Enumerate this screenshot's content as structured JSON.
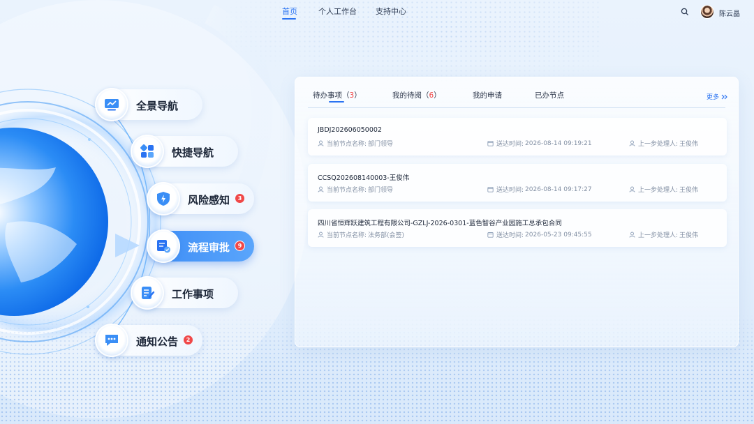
{
  "header": {
    "nav": [
      {
        "label": "首页",
        "active": true
      },
      {
        "label": "个人工作台",
        "active": false
      },
      {
        "label": "支持中心",
        "active": false
      }
    ],
    "user_name": "陈云晶",
    "search_icon": "search-icon"
  },
  "sidebar": {
    "items": [
      {
        "label": "全景导航",
        "icon": "monitor-chart-icon",
        "badge": ""
      },
      {
        "label": "快捷导航",
        "icon": "grid-apps-icon",
        "badge": ""
      },
      {
        "label": "风险感知",
        "icon": "shield-bolt-icon",
        "badge": "3"
      },
      {
        "label": "流程审批",
        "icon": "approval-flow-icon",
        "badge": "9",
        "active": true
      },
      {
        "label": "工作事项",
        "icon": "task-list-icon",
        "badge": ""
      },
      {
        "label": "通知公告",
        "icon": "chat-bubble-icon",
        "badge": "2"
      }
    ]
  },
  "panel": {
    "tabs": [
      {
        "label": "待办事项",
        "count": "3",
        "active": true
      },
      {
        "label": "我的待阅",
        "count": "6",
        "active": false
      },
      {
        "label": "我的申请",
        "count": "",
        "active": false
      },
      {
        "label": "已办节点",
        "count": "",
        "active": false
      }
    ],
    "more": "更多",
    "tasks": [
      {
        "title": "JBDJ202606050002",
        "node_label": "当前节点名称:",
        "node": "部门领导",
        "time_label": "送达时间:",
        "time": "2026-08-14 09:19:21",
        "prev_label": "上一步处理人:",
        "prev": "王俊伟"
      },
      {
        "title": "CCSQ202608140003-王俊伟",
        "node_label": "当前节点名称:",
        "node": "部门领导",
        "time_label": "送达时间:",
        "time": "2026-08-14 09:17:27",
        "prev_label": "上一步处理人:",
        "prev": "王俊伟"
      },
      {
        "title": "四川省恒辉跃建筑工程有限公司-GZLJ-2026-0301-蓝色智谷产业园施工总承包合同",
        "node_label": "当前节点名称:",
        "node": "法务部(会签)",
        "time_label": "送达时间:",
        "time": "2026-05-23 09:45:55",
        "prev_label": "上一步处理人:",
        "prev": "王俊伟"
      }
    ]
  },
  "colors": {
    "accent": "#2a73f2",
    "badge": "#f04848",
    "active_item": "#3d8df6"
  }
}
